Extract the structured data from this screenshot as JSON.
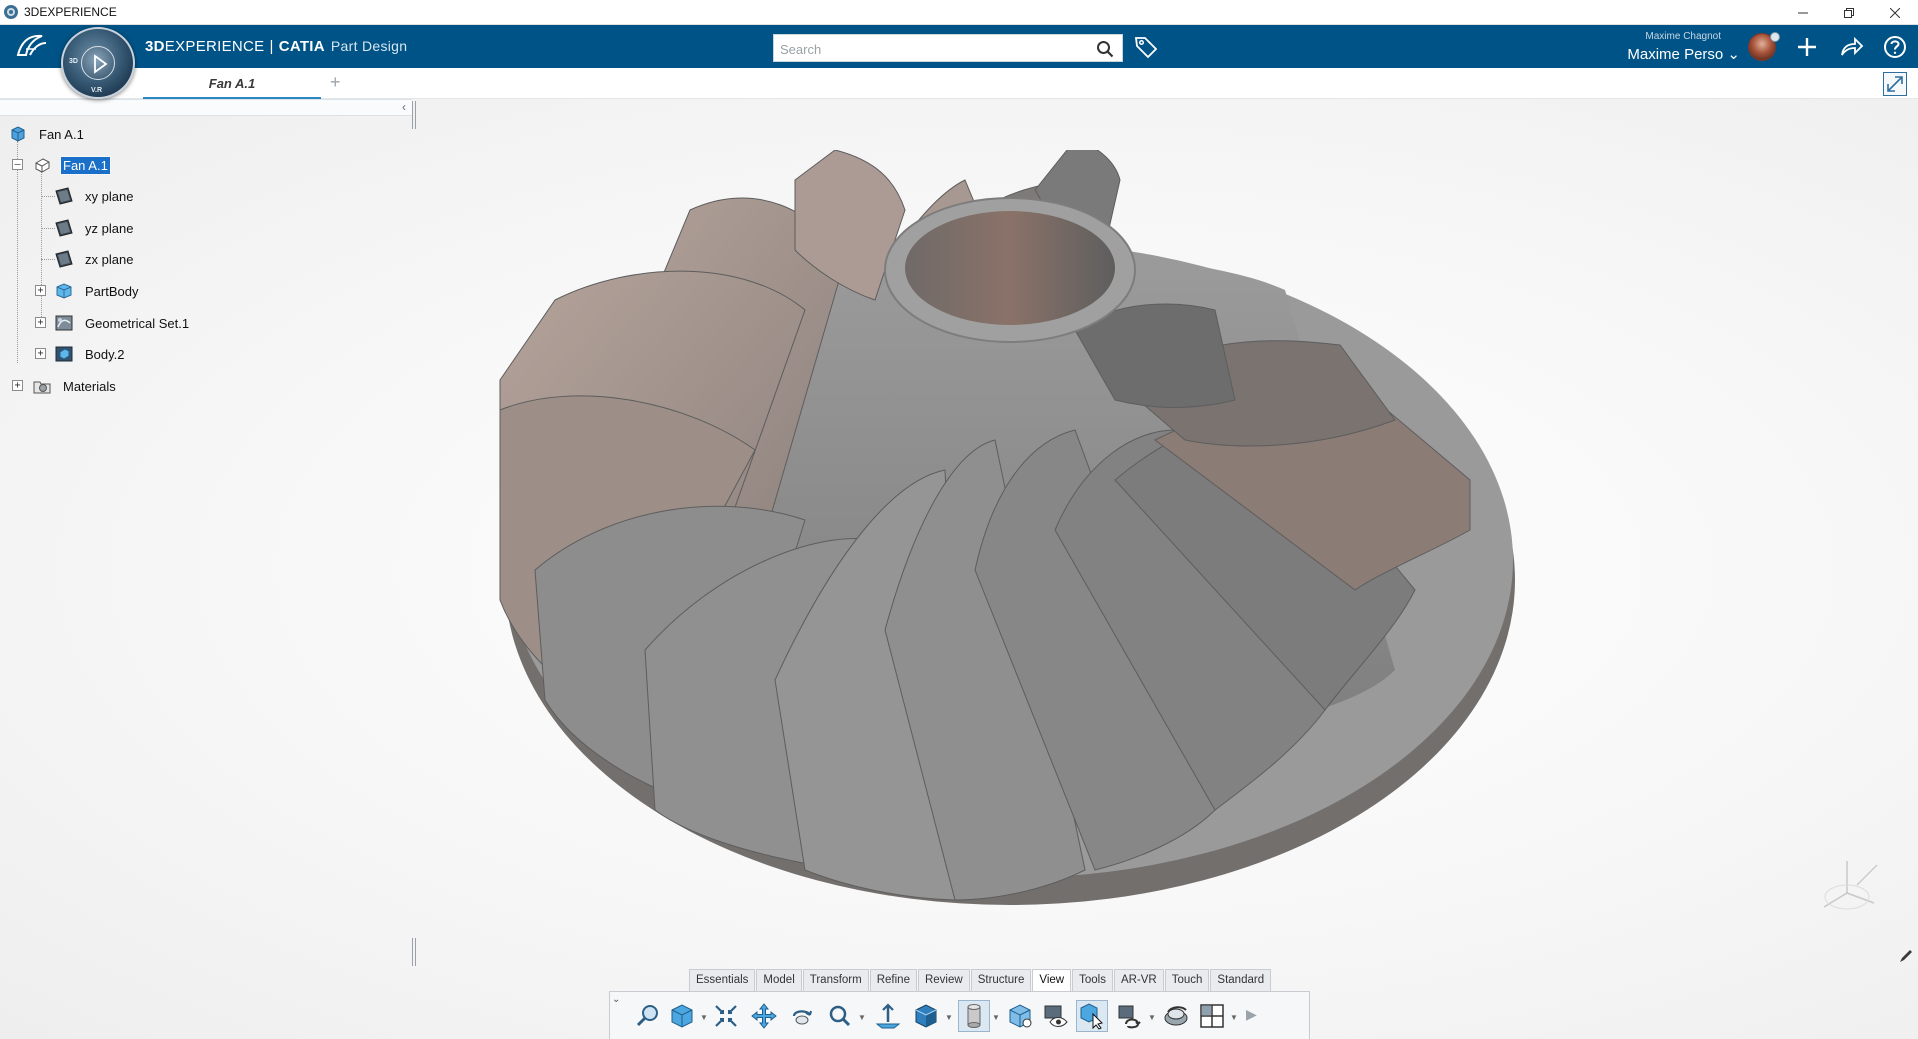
{
  "window": {
    "title": "3DEXPERIENCE"
  },
  "topbar": {
    "brand_3d": "3D",
    "brand_experience": "EXPERIENCE",
    "brand_separator": "|",
    "brand_app": "CATIA",
    "brand_role": "Part Design",
    "search_placeholder": "Search",
    "user_subtitle": "Maxime Chagnot",
    "user_name": "Maxime Perso",
    "user_menu_chevron": "⌄",
    "compass_labels": [
      "3D",
      "V.R"
    ]
  },
  "tabs": {
    "document_tab": "Fan A.1",
    "add_tab": "+"
  },
  "tree": {
    "root": "Fan A.1",
    "part": "Fan A.1",
    "children": [
      "xy plane",
      "yz plane",
      "zx plane",
      "PartBody",
      "Geometrical Set.1",
      "Body.2"
    ],
    "materials": "Materials"
  },
  "section_tabs": [
    "Essentials",
    "Model",
    "Transform",
    "Refine",
    "Review",
    "Structure",
    "View",
    "Tools",
    "AR-VR",
    "Touch",
    "Standard"
  ],
  "active_section": "View",
  "colors": {
    "topbar": "#005386",
    "accent": "#2d86c4",
    "selection": "#1a70c8",
    "model_blade_light": "#a8948c",
    "model_blade_dark": "#6b6b6b",
    "model_hub": "#8c8c8c"
  },
  "icons": {
    "app": "3dexperience-icon",
    "search": "search-icon",
    "tag": "tag-icon",
    "add": "plus-icon",
    "share": "share-icon",
    "help": "help-icon"
  }
}
